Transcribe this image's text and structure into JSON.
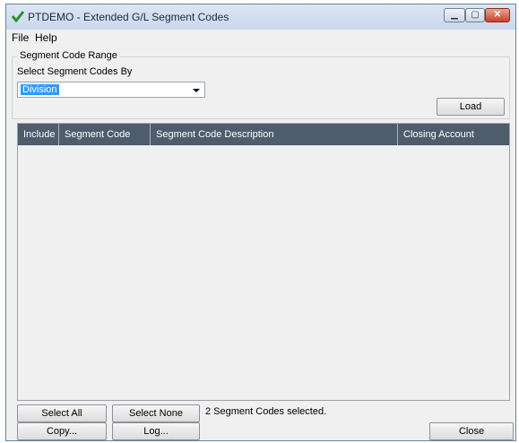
{
  "window": {
    "title": "PTDEMO - Extended G/L Segment Codes"
  },
  "menu": {
    "items": [
      "File",
      "Help"
    ]
  },
  "range_group": {
    "legend": "Segment Code Range",
    "select_label": "Select Segment Codes By",
    "select_value": "Division",
    "load_label": "Load"
  },
  "grid": {
    "columns": [
      "Include",
      "Segment Code",
      "Segment Code Description",
      "Closing Account"
    ],
    "rows": []
  },
  "footer": {
    "select_all_label": "Select All",
    "select_none_label": "Select None",
    "status_text": "2 Segment Codes selected.",
    "copy_label": "Copy...",
    "log_label": "Log...",
    "close_label": "Close"
  },
  "colors": {
    "header_bg": "#4e5c6c",
    "selection": "#3399ff",
    "close_button": "#c9412a"
  },
  "icons": [
    "app-check-icon",
    "minimize-icon",
    "maximize-icon",
    "close-icon",
    "dropdown-arrow-icon"
  ]
}
